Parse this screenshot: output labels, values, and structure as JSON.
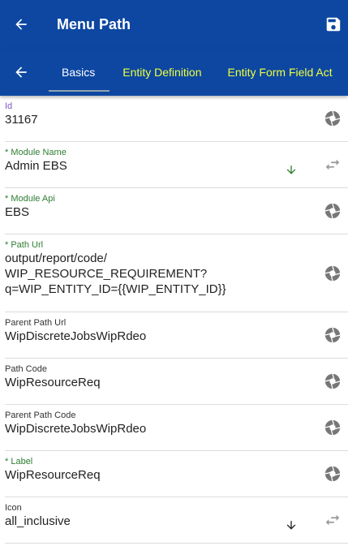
{
  "appbar": {
    "title": "Menu Path"
  },
  "tabs": [
    "Basics",
    "Entity Definition",
    "Entity Form Field Act"
  ],
  "fields": [
    {
      "label": "Id",
      "value": "31167",
      "label_color": "purple",
      "icon": "shutter-icon"
    },
    {
      "label": "* Module Name",
      "value": "Admin EBS",
      "label_color": "green",
      "icon": "swap-icon",
      "dropdown": true
    },
    {
      "label": "* Module Api",
      "value": "EBS",
      "label_color": "green",
      "icon": "shutter-icon"
    },
    {
      "label": "* Path Url",
      "value_lines": [
        "output/report/code/",
        "WIP_RESOURCE_REQUIREMENT?",
        "q=WIP_ENTITY_ID={{WIP_ENTITY_ID}}"
      ],
      "label_color": "green",
      "icon": "shutter-icon"
    },
    {
      "label": "Parent Path Url",
      "value": "WipDiscreteJobsWipRdeo",
      "label_color": "plain",
      "icon": "shutter-icon"
    },
    {
      "label": "Path Code",
      "value": "WipResourceReq",
      "label_color": "plain",
      "icon": "shutter-icon"
    },
    {
      "label": "Parent Path Code",
      "value": "WipDiscreteJobsWipRdeo",
      "label_color": "plain",
      "icon": "shutter-icon"
    },
    {
      "label": "* Label",
      "value": "WipResourceReq",
      "label_color": "green",
      "icon": "shutter-icon"
    },
    {
      "label": "Icon",
      "value": "all_inclusive",
      "label_color": "plain",
      "icon": "swap-icon",
      "dropdown": true
    }
  ],
  "colors": {
    "primary": "#0d47a1",
    "tab_inactive": "#eeff41",
    "label_green": "#2e7d32",
    "label_purple": "#7e57c2"
  }
}
